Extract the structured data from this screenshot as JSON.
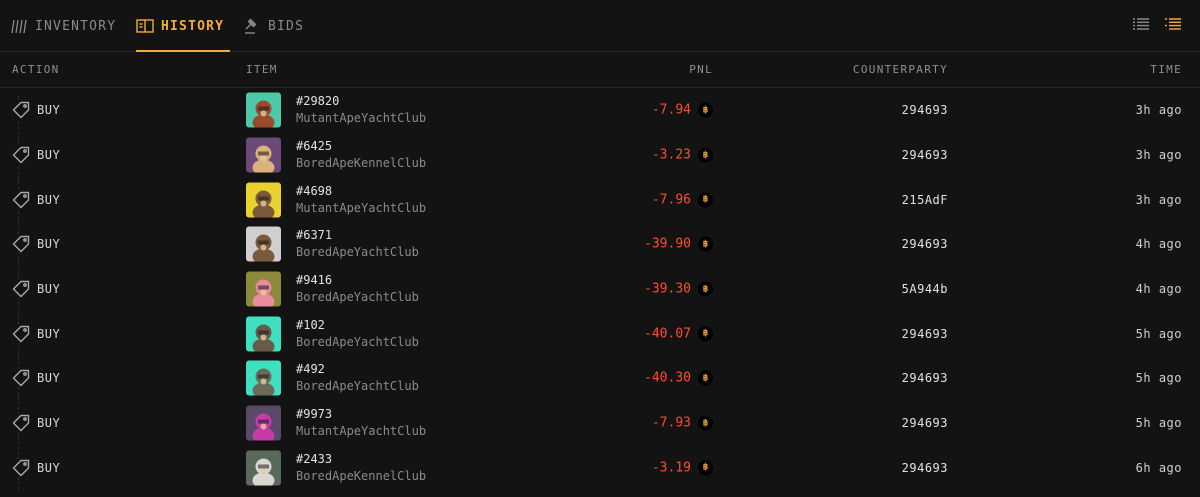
{
  "tabs": [
    {
      "label": "INVENTORY",
      "icon": "inventory-icon",
      "active": false
    },
    {
      "label": "HISTORY",
      "icon": "book-icon",
      "active": true
    },
    {
      "label": "BIDS",
      "icon": "gavel-icon",
      "active": false
    }
  ],
  "view_toggles": [
    {
      "icon": "list-view-icon",
      "active": false
    },
    {
      "icon": "detail-list-icon",
      "active": true
    }
  ],
  "colors": {
    "accent": "#f6a93b",
    "negative": "#ff4d2e",
    "background": "#131313"
  },
  "columns": {
    "action": "ACTION",
    "item": "ITEM",
    "pnl": "PNL",
    "counterparty": "COUNTERPARTY",
    "time": "TIME"
  },
  "rows": [
    {
      "action": "BUY",
      "token": "#29820",
      "collection": "MutantApeYachtClub",
      "pnl": "-7.94",
      "counterparty": "294693",
      "time": "3h ago",
      "thumb_bg": "#4cc9a8",
      "thumb_fg": "#9a4a2a"
    },
    {
      "action": "BUY",
      "token": "#6425",
      "collection": "BoredApeKennelClub",
      "pnl": "-3.23",
      "counterparty": "294693",
      "time": "3h ago",
      "thumb_bg": "#6b4a7a",
      "thumb_fg": "#d9b37a"
    },
    {
      "action": "BUY",
      "token": "#4698",
      "collection": "MutantApeYachtClub",
      "pnl": "-7.96",
      "counterparty": "215AdF",
      "time": "3h ago",
      "thumb_bg": "#e8d230",
      "thumb_fg": "#7a5a3a"
    },
    {
      "action": "BUY",
      "token": "#6371",
      "collection": "BoredApeYachtClub",
      "pnl": "-39.90",
      "counterparty": "294693",
      "time": "4h ago",
      "thumb_bg": "#cfcfcf",
      "thumb_fg": "#7a5a3a"
    },
    {
      "action": "BUY",
      "token": "#9416",
      "collection": "BoredApeYachtClub",
      "pnl": "-39.30",
      "counterparty": "5A944b",
      "time": "4h ago",
      "thumb_bg": "#8a8a3a",
      "thumb_fg": "#e88aa0"
    },
    {
      "action": "BUY",
      "token": "#102",
      "collection": "BoredApeYachtClub",
      "pnl": "-40.07",
      "counterparty": "294693",
      "time": "5h ago",
      "thumb_bg": "#3fe0c0",
      "thumb_fg": "#6a5a4a"
    },
    {
      "action": "BUY",
      "token": "#492",
      "collection": "BoredApeYachtClub",
      "pnl": "-40.30",
      "counterparty": "294693",
      "time": "5h ago",
      "thumb_bg": "#3fe0c0",
      "thumb_fg": "#6a6a5a"
    },
    {
      "action": "BUY",
      "token": "#9973",
      "collection": "MutantApeYachtClub",
      "pnl": "-7.93",
      "counterparty": "294693",
      "time": "5h ago",
      "thumb_bg": "#5a4a6a",
      "thumb_fg": "#c83aa8"
    },
    {
      "action": "BUY",
      "token": "#2433",
      "collection": "BoredApeKennelClub",
      "pnl": "-3.19",
      "counterparty": "294693",
      "time": "6h ago",
      "thumb_bg": "#5a6a5a",
      "thumb_fg": "#d8d8d0"
    }
  ],
  "currency_icon": "coin-icon"
}
